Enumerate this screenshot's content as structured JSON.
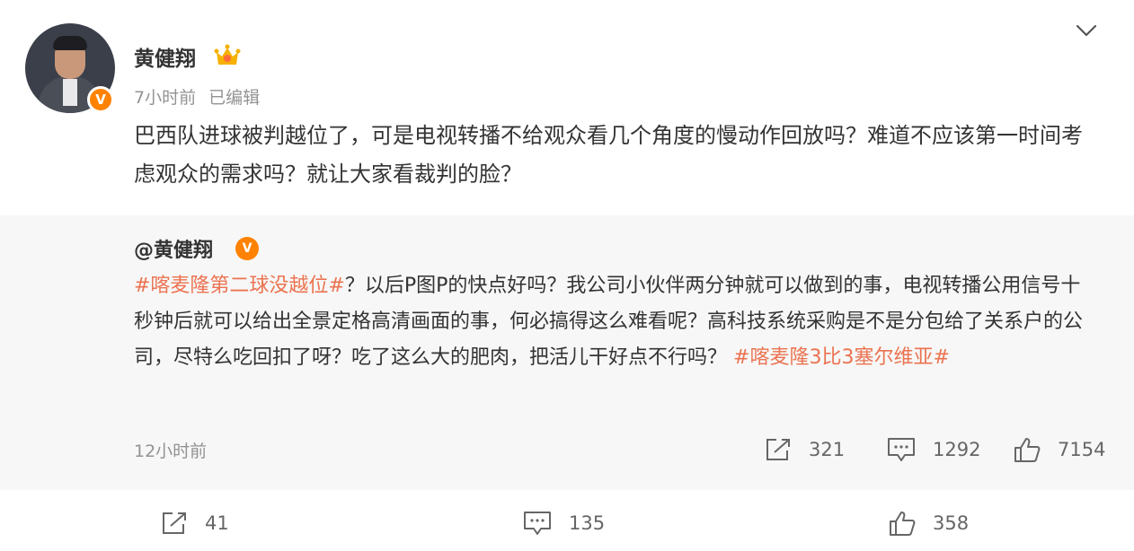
{
  "post": {
    "author": "黄健翔",
    "time": "7小时前",
    "edited": "已编辑",
    "text": "巴西队进球被判越位了，可是电视转播不给观众看几个角度的慢动作回放吗？难道不应该第一时间考虑观众的需求吗？就让大家看裁判的脸？",
    "badge_letter": "V"
  },
  "retweet": {
    "author": "@黄健翔",
    "topic1": "#喀麦隆第二球没越位#",
    "body": "？以后P图P的快点好吗？我公司小伙伴两分钟就可以做到的事，电视转播公用信号十秒钟后就可以给出全景定格高清画面的事，何必搞得这么难看呢？高科技系统采购是不是分包给了关系户的公司，尽特么吃回扣了呀？吃了这么大的肥肉，把活儿干好点不行吗？",
    "topic2": "#喀麦隆3比3塞尔维亚#",
    "time": "12小时前",
    "reposts": "321",
    "comments": "1292",
    "likes": "7154"
  },
  "actions": {
    "reposts": "41",
    "comments": "135",
    "likes": "358"
  },
  "colors": {
    "accent": "#ff8200",
    "topic": "#eb7350",
    "muted": "#939393",
    "retweet_bg": "#f7f7f7"
  },
  "icons": [
    "crown-icon",
    "chevron-down-icon",
    "repost-icon",
    "comment-icon",
    "like-icon",
    "verified-icon"
  ]
}
